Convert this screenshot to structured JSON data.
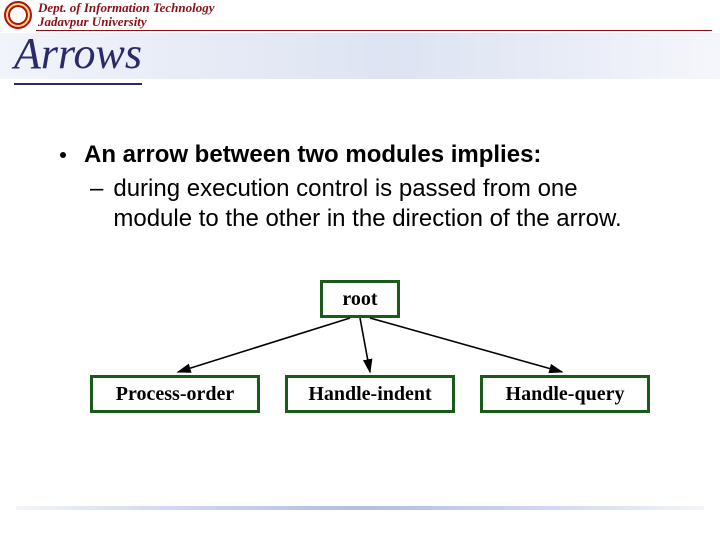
{
  "header": {
    "dept_line1": "Dept. of Information Technology",
    "dept_line2": "Jadavpur University"
  },
  "title": "Arrows",
  "bullets": {
    "main": "An arrow between two modules implies:",
    "sub": "during  execution control is passed from one module to the other in the direction of the arrow."
  },
  "diagram": {
    "root": "root",
    "child1": "Process-order",
    "child2": "Handle-indent",
    "child3": "Handle-query"
  }
}
